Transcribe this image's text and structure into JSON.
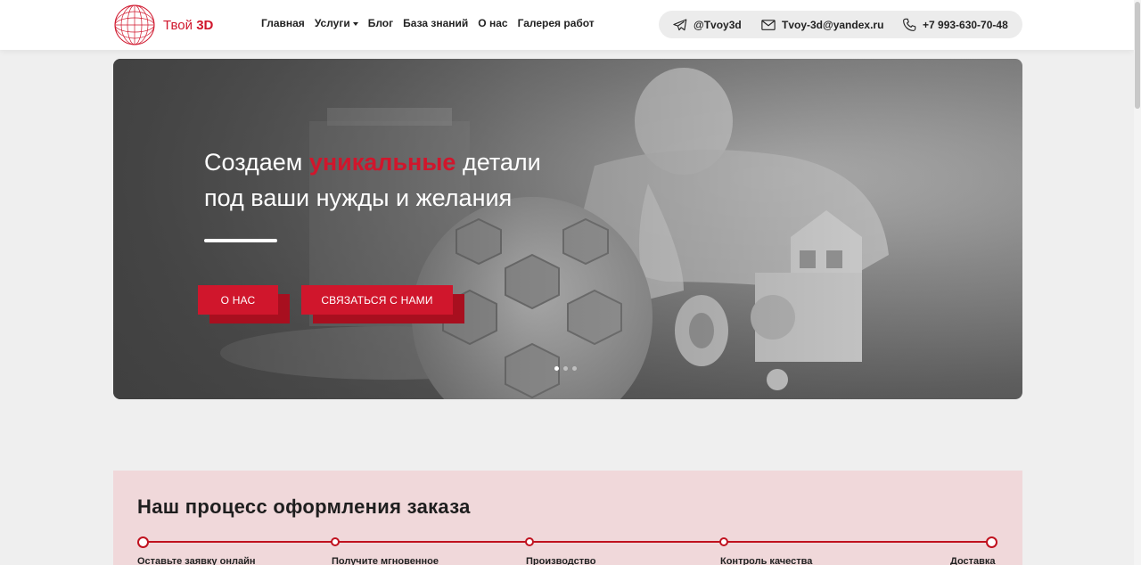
{
  "header": {
    "logo_text_regular": "Твой",
    "logo_text_bold": "3D",
    "nav": [
      {
        "label": "Главная"
      },
      {
        "label": "Услуги"
      },
      {
        "label": "Блог"
      },
      {
        "label": "База знаний"
      },
      {
        "label": "О нас"
      },
      {
        "label": "Галерея работ"
      }
    ],
    "contacts": {
      "telegram": "@Tvoy3d",
      "email": "Tvoy-3d@yandex.ru",
      "phone": "+7 993-630-70-48"
    }
  },
  "hero": {
    "title_before": "Создаем ",
    "title_accent": "уникальные",
    "title_after": " детали",
    "title_line2": "под ваши нужды и желания",
    "buttons": {
      "about": "О нас",
      "contact": "Связаться с нами"
    },
    "slides_total": 3,
    "active_slide": 1
  },
  "process": {
    "title": "Наш процесс оформления заказа",
    "steps": [
      {
        "label": "Оставьте заявку онлайн"
      },
      {
        "label": "Получите мгновенное"
      },
      {
        "label": "Производство"
      },
      {
        "label": "Контроль качества"
      },
      {
        "label": "Доставка"
      }
    ]
  },
  "colors": {
    "accent": "#d0162c",
    "process_bg": "#f0d8da",
    "page_bg": "#efefef"
  }
}
